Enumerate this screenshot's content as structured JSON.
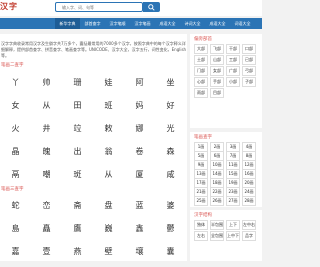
{
  "header": {
    "logo": "汉字网",
    "search_placeholder": "输入字、词、句等"
  },
  "nav": [
    "新华字典",
    "部首查字",
    "汉字笔顺",
    "汉字笔画",
    "成语大全",
    "诗词大全",
    "成语大全",
    "词语大全"
  ],
  "intro": "汉字字典收录常用汉字及生僻字共7万多个，囊括最常用的7000多个汉字，按照字典中的每个汉字释义详细解释，提供部首查字、拼音查字、笔画查字等。UNICODE、汉字大全，汉字五行，词性变化，English等。",
  "section1": {
    "title": "笔画二查字",
    "rows": [
      [
        {
          "py": "",
          "hz": "丫"
        },
        {
          "py": "",
          "hz": "帅"
        },
        {
          "py": "",
          "hz": "珊"
        },
        {
          "py": "",
          "hz": "娃"
        },
        {
          "py": "",
          "hz": "阿"
        },
        {
          "py": "",
          "hz": "坐"
        }
      ],
      [
        {
          "py": "",
          "hz": "女"
        },
        {
          "py": "",
          "hz": "从"
        },
        {
          "py": "",
          "hz": "田"
        },
        {
          "py": "",
          "hz": "班"
        },
        {
          "py": "",
          "hz": "妈"
        },
        {
          "py": "",
          "hz": "好"
        }
      ],
      [
        {
          "py": "",
          "hz": "火"
        },
        {
          "py": "",
          "hz": "井"
        },
        {
          "py": "",
          "hz": "竝"
        },
        {
          "py": "",
          "hz": "敕"
        },
        {
          "py": "",
          "hz": "娜"
        },
        {
          "py": "",
          "hz": "光"
        }
      ],
      [
        {
          "py": "",
          "hz": "晶"
        },
        {
          "py": "",
          "hz": "魄"
        },
        {
          "py": "",
          "hz": "出"
        },
        {
          "py": "",
          "hz": "翁"
        },
        {
          "py": "",
          "hz": "卷"
        },
        {
          "py": "",
          "hz": "森"
        }
      ],
      [
        {
          "py": "",
          "hz": "鬲"
        },
        {
          "py": "",
          "hz": "嘲"
        },
        {
          "py": "",
          "hz": "斑"
        },
        {
          "py": "",
          "hz": "从"
        },
        {
          "py": "",
          "hz": "厦"
        },
        {
          "py": "",
          "hz": "咸"
        }
      ]
    ]
  },
  "section2": {
    "title": "笔画三查字",
    "rows": [
      [
        {
          "py": "",
          "hz": "蛇"
        },
        {
          "py": "",
          "hz": "峦"
        },
        {
          "py": "",
          "hz": "斋"
        },
        {
          "py": "",
          "hz": "盘"
        },
        {
          "py": "",
          "hz": "蓝"
        },
        {
          "py": "",
          "hz": "婆"
        }
      ],
      [
        {
          "py": "",
          "hz": "島"
        },
        {
          "py": "",
          "hz": "矗"
        },
        {
          "py": "",
          "hz": "鷹"
        },
        {
          "py": "",
          "hz": "巍"
        },
        {
          "py": "",
          "hz": "鑫"
        },
        {
          "py": "",
          "hz": "鬱"
        }
      ],
      [
        {
          "py": "",
          "hz": "嘉"
        },
        {
          "py": "",
          "hz": "壹"
        },
        {
          "py": "",
          "hz": "燕"
        },
        {
          "py": "",
          "hz": "壁"
        },
        {
          "py": "",
          "hz": "壤"
        },
        {
          "py": "",
          "hz": "囊"
        }
      ]
    ]
  },
  "radicals": {
    "title": "偏旁部首",
    "items": [
      "大部",
      "飞部",
      "干部",
      "口部",
      "土部",
      "山部",
      "工部",
      "已部",
      "门部",
      "女部",
      "广部",
      "弓部",
      "心部",
      "手部",
      "小部",
      "子部",
      "雨部",
      "目部"
    ]
  },
  "strokes": {
    "title": "笔画查字",
    "items": [
      "1画",
      "2画",
      "3画",
      "4画",
      "5画",
      "6画",
      "7画",
      "8画",
      "9画",
      "10画",
      "11画",
      "12画",
      "13画",
      "14画",
      "15画",
      "16画",
      "17画",
      "18画",
      "19画",
      "20画",
      "21画",
      "22画",
      "23画",
      "24画",
      "25画",
      "26画",
      "27画",
      "28画"
    ]
  },
  "structure": {
    "title": "汉字结构",
    "items": [
      "独体",
      "半包围",
      "上下",
      "左中右",
      "左右",
      "全包围",
      "上中下",
      "品字"
    ]
  }
}
